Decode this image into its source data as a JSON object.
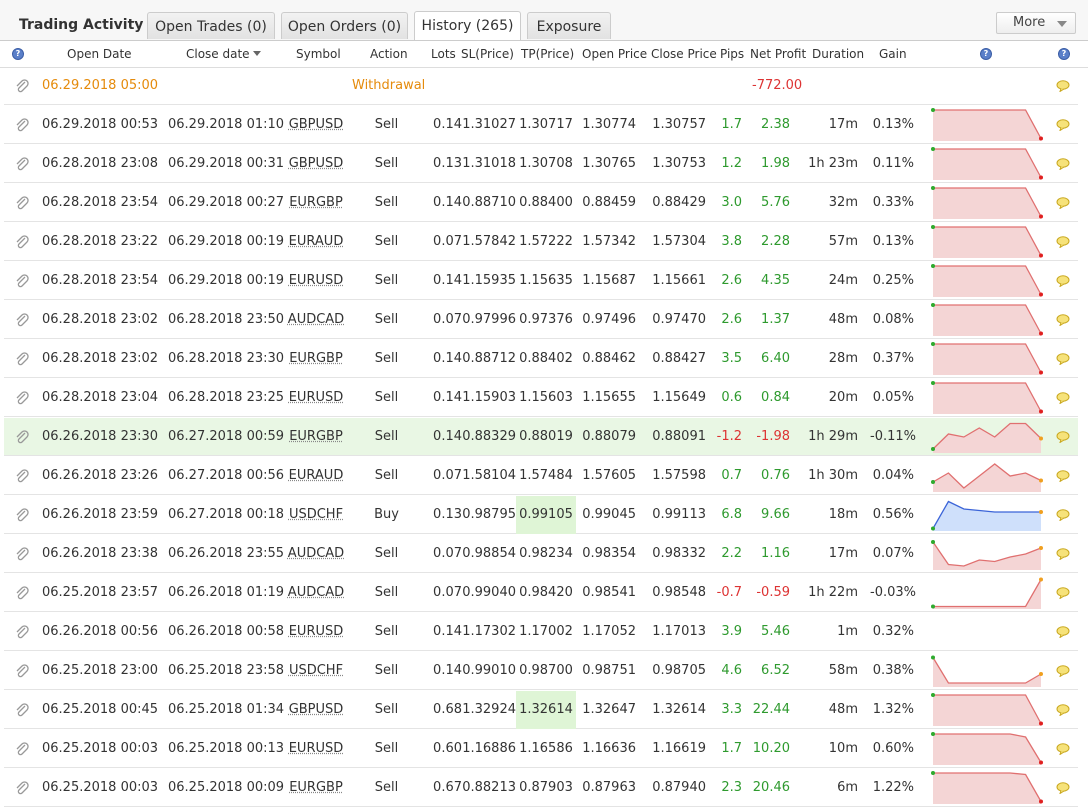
{
  "title": "Trading Activity",
  "tabs": [
    {
      "label": "Open Trades (0)",
      "active": false
    },
    {
      "label": "Open Orders (0)",
      "active": false
    },
    {
      "label": "History (265)",
      "active": true
    },
    {
      "label": "Exposure",
      "active": false
    }
  ],
  "more_label": "More",
  "columns": [
    "Open Date",
    "Close date",
    "Symbol",
    "Action",
    "Lots",
    "SL(Price)",
    "TP(Price)",
    "Open Price",
    "Close Price",
    "Pips",
    "Net Profit",
    "Duration",
    "Gain"
  ],
  "help_glyph": "?",
  "colors": {
    "positive": "#2e9a2e",
    "negative": "#d33333",
    "withdrawal": "#e58b0c",
    "highlight_row": "#e9f7e4",
    "tp_highlight": "#dff5d6"
  },
  "withdrawal_row": {
    "open_date": "06.29.2018 05:00",
    "action": "Withdrawal",
    "net_profit": "-772.00"
  },
  "rows": [
    {
      "open": "06.29.2018 00:53",
      "close": "06.29.2018 01:10",
      "symbol": "GBPUSD",
      "action": "Sell",
      "lots": "0.14",
      "sl": "1.31027",
      "tp": "1.30717",
      "open_price": "1.30774",
      "close_price": "1.30757",
      "pips": "1.7",
      "profit": "2.38",
      "duration": "17m",
      "gain": "0.13%",
      "tp_hl": false,
      "hl": false,
      "spark": [
        0,
        0,
        0,
        0,
        0,
        0,
        0,
        0.95
      ]
    },
    {
      "open": "06.28.2018 23:08",
      "close": "06.29.2018 00:31",
      "symbol": "GBPUSD",
      "action": "Sell",
      "lots": "0.13",
      "sl": "1.31018",
      "tp": "1.30708",
      "open_price": "1.30765",
      "close_price": "1.30753",
      "pips": "1.2",
      "profit": "1.98",
      "duration": "1h 23m",
      "gain": "0.11%",
      "tp_hl": false,
      "hl": false,
      "spark": [
        0,
        0,
        0,
        0,
        0,
        0,
        0,
        0.95
      ]
    },
    {
      "open": "06.28.2018 23:54",
      "close": "06.29.2018 00:27",
      "symbol": "EURGBP",
      "action": "Sell",
      "lots": "0.14",
      "sl": "0.88710",
      "tp": "0.88400",
      "open_price": "0.88459",
      "close_price": "0.88429",
      "pips": "3.0",
      "profit": "5.76",
      "duration": "32m",
      "gain": "0.33%",
      "tp_hl": false,
      "hl": false,
      "spark": [
        0,
        0,
        0,
        0,
        0,
        0,
        0,
        0.95
      ]
    },
    {
      "open": "06.28.2018 23:22",
      "close": "06.29.2018 00:19",
      "symbol": "EURAUD",
      "action": "Sell",
      "lots": "0.07",
      "sl": "1.57842",
      "tp": "1.57222",
      "open_price": "1.57342",
      "close_price": "1.57304",
      "pips": "3.8",
      "profit": "2.28",
      "duration": "57m",
      "gain": "0.13%",
      "tp_hl": false,
      "hl": false,
      "spark": [
        0,
        0,
        0,
        0,
        0,
        0,
        0,
        0.95
      ]
    },
    {
      "open": "06.28.2018 23:54",
      "close": "06.29.2018 00:19",
      "symbol": "EURUSD",
      "action": "Sell",
      "lots": "0.14",
      "sl": "1.15935",
      "tp": "1.15635",
      "open_price": "1.15687",
      "close_price": "1.15661",
      "pips": "2.6",
      "profit": "4.35",
      "duration": "24m",
      "gain": "0.25%",
      "tp_hl": false,
      "hl": false,
      "spark": [
        0,
        0,
        0,
        0,
        0,
        0,
        0,
        0.95
      ]
    },
    {
      "open": "06.28.2018 23:02",
      "close": "06.28.2018 23:50",
      "symbol": "AUDCAD",
      "action": "Sell",
      "lots": "0.07",
      "sl": "0.97996",
      "tp": "0.97376",
      "open_price": "0.97496",
      "close_price": "0.97470",
      "pips": "2.6",
      "profit": "1.37",
      "duration": "48m",
      "gain": "0.08%",
      "tp_hl": false,
      "hl": false,
      "spark": [
        0,
        0,
        0,
        0,
        0,
        0,
        0,
        0.95
      ]
    },
    {
      "open": "06.28.2018 23:02",
      "close": "06.28.2018 23:30",
      "symbol": "EURGBP",
      "action": "Sell",
      "lots": "0.14",
      "sl": "0.88712",
      "tp": "0.88402",
      "open_price": "0.88462",
      "close_price": "0.88427",
      "pips": "3.5",
      "profit": "6.40",
      "duration": "28m",
      "gain": "0.37%",
      "tp_hl": false,
      "hl": false,
      "spark": [
        0,
        0,
        0,
        0,
        0,
        0,
        0,
        0.95
      ]
    },
    {
      "open": "06.28.2018 23:04",
      "close": "06.28.2018 23:25",
      "symbol": "EURUSD",
      "action": "Sell",
      "lots": "0.14",
      "sl": "1.15903",
      "tp": "1.15603",
      "open_price": "1.15655",
      "close_price": "1.15649",
      "pips": "0.6",
      "profit": "0.84",
      "duration": "20m",
      "gain": "0.05%",
      "tp_hl": false,
      "hl": false,
      "spark": [
        0,
        0,
        0,
        0,
        0,
        0,
        0,
        0.95
      ]
    },
    {
      "open": "06.26.2018 23:30",
      "close": "06.27.2018 00:59",
      "symbol": "EURGBP",
      "action": "Sell",
      "lots": "0.14",
      "sl": "0.88329",
      "tp": "0.88019",
      "open_price": "0.88079",
      "close_price": "0.88091",
      "pips": "-1.2",
      "profit": "-1.98",
      "duration": "1h 29m",
      "gain": "-0.11%",
      "tp_hl": false,
      "hl": true,
      "spark": [
        0.9,
        0.4,
        0.5,
        0.2,
        0.5,
        0.05,
        0.05,
        0.55
      ]
    },
    {
      "open": "06.26.2018 23:26",
      "close": "06.27.2018 00:56",
      "symbol": "EURAUD",
      "action": "Sell",
      "lots": "0.07",
      "sl": "1.58104",
      "tp": "1.57484",
      "open_price": "1.57605",
      "close_price": "1.57598",
      "pips": "0.7",
      "profit": "0.76",
      "duration": "1h 30m",
      "gain": "0.04%",
      "tp_hl": false,
      "hl": false,
      "spark": [
        0.7,
        0.4,
        0.9,
        0.5,
        0.1,
        0.5,
        0.4,
        0.65
      ]
    },
    {
      "open": "06.26.2018 23:59",
      "close": "06.27.2018 00:18",
      "symbol": "USDCHF",
      "action": "Buy",
      "lots": "0.13",
      "sl": "0.98795",
      "tp": "0.99105",
      "open_price": "0.99045",
      "close_price": "0.99113",
      "pips": "6.8",
      "profit": "9.66",
      "duration": "18m",
      "gain": "0.56%",
      "tp_hl": true,
      "hl": false,
      "spark": [
        0.95,
        0.05,
        0.3,
        0.35,
        0.4,
        0.4,
        0.4,
        0.4
      ],
      "fill": "blue"
    },
    {
      "open": "06.26.2018 23:38",
      "close": "06.26.2018 23:55",
      "symbol": "AUDCAD",
      "action": "Sell",
      "lots": "0.07",
      "sl": "0.98854",
      "tp": "0.98234",
      "open_price": "0.98354",
      "close_price": "0.98332",
      "pips": "2.2",
      "profit": "1.16",
      "duration": "17m",
      "gain": "0.07%",
      "tp_hl": false,
      "hl": false,
      "spark": [
        0.1,
        0.85,
        0.9,
        0.7,
        0.75,
        0.6,
        0.5,
        0.3
      ]
    },
    {
      "open": "06.25.2018 23:57",
      "close": "06.26.2018 01:19",
      "symbol": "AUDCAD",
      "action": "Sell",
      "lots": "0.07",
      "sl": "0.99040",
      "tp": "0.98420",
      "open_price": "0.98541",
      "close_price": "0.98548",
      "pips": "-0.7",
      "profit": "-0.59",
      "duration": "1h 22m",
      "gain": "-0.03%",
      "tp_hl": false,
      "hl": false,
      "spark": [
        0.95,
        0.95,
        0.95,
        0.95,
        0.95,
        0.95,
        0.95,
        0.05
      ]
    },
    {
      "open": "06.26.2018 00:56",
      "close": "06.26.2018 00:58",
      "symbol": "EURUSD",
      "action": "Sell",
      "lots": "0.14",
      "sl": "1.17302",
      "tp": "1.17002",
      "open_price": "1.17052",
      "close_price": "1.17013",
      "pips": "3.9",
      "profit": "5.46",
      "duration": "1m",
      "gain": "0.32%",
      "tp_hl": false,
      "hl": false,
      "spark": null
    },
    {
      "open": "06.25.2018 23:00",
      "close": "06.25.2018 23:58",
      "symbol": "USDCHF",
      "action": "Sell",
      "lots": "0.14",
      "sl": "0.99010",
      "tp": "0.98700",
      "open_price": "0.98751",
      "close_price": "0.98705",
      "pips": "4.6",
      "profit": "6.52",
      "duration": "58m",
      "gain": "0.38%",
      "tp_hl": false,
      "hl": false,
      "spark": [
        0.05,
        0.9,
        0.9,
        0.9,
        0.9,
        0.9,
        0.9,
        0.6
      ]
    },
    {
      "open": "06.25.2018 00:45",
      "close": "06.25.2018 01:34",
      "symbol": "GBPUSD",
      "action": "Sell",
      "lots": "0.68",
      "sl": "1.32924",
      "tp": "1.32614",
      "open_price": "1.32647",
      "close_price": "1.32614",
      "pips": "3.3",
      "profit": "22.44",
      "duration": "48m",
      "gain": "1.32%",
      "tp_hl": true,
      "hl": false,
      "spark": [
        0,
        0,
        0,
        0,
        0,
        0,
        0,
        0.95
      ]
    },
    {
      "open": "06.25.2018 00:03",
      "close": "06.25.2018 00:13",
      "symbol": "EURUSD",
      "action": "Sell",
      "lots": "0.60",
      "sl": "1.16886",
      "tp": "1.16586",
      "open_price": "1.16636",
      "close_price": "1.16619",
      "pips": "1.7",
      "profit": "10.20",
      "duration": "10m",
      "gain": "0.60%",
      "tp_hl": false,
      "hl": false,
      "spark": [
        0,
        0,
        0,
        0,
        0,
        0,
        0.1,
        0.95
      ]
    },
    {
      "open": "06.25.2018 00:03",
      "close": "06.25.2018 00:09",
      "symbol": "EURGBP",
      "action": "Sell",
      "lots": "0.67",
      "sl": "0.88213",
      "tp": "0.87903",
      "open_price": "0.87963",
      "close_price": "0.87940",
      "pips": "2.3",
      "profit": "20.46",
      "duration": "6m",
      "gain": "1.22%",
      "tp_hl": false,
      "hl": false,
      "spark": [
        0,
        0,
        0,
        0,
        0,
        0,
        0.05,
        0.95
      ]
    }
  ]
}
